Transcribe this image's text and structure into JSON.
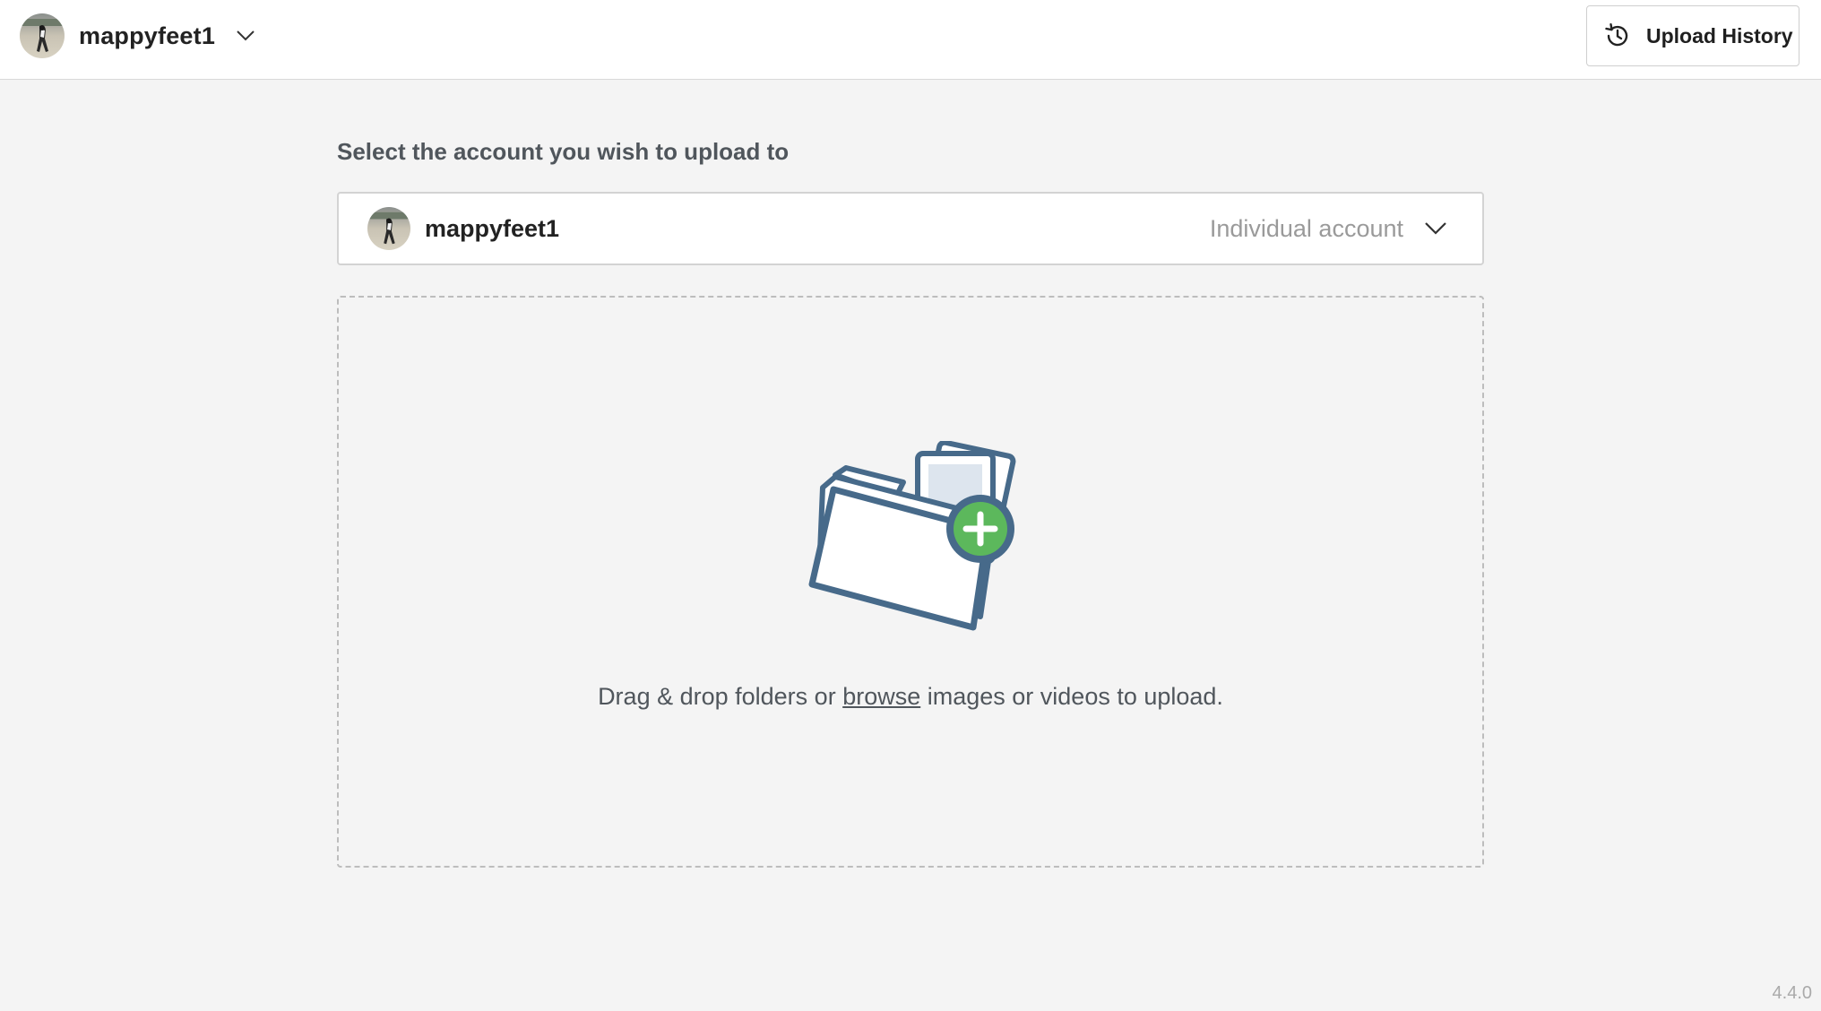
{
  "header": {
    "username": "mappyfeet1",
    "history_button_label": "Upload History"
  },
  "main": {
    "section_label": "Select the account you wish to upload to",
    "account": {
      "name": "mappyfeet1",
      "type": "Individual account"
    },
    "dropzone": {
      "text_before": "Drag & drop folders or ",
      "browse_link": "browse",
      "text_after": " images or videos to upload."
    }
  },
  "footer": {
    "version": "4.4.0"
  },
  "icons": {
    "header_dropdown": "chevron-down-icon",
    "history": "history-clock-icon",
    "account_dropdown": "chevron-down-icon",
    "illustration": "folder-add-icon"
  },
  "colors": {
    "folder_stroke": "#476a8a",
    "add_badge": "#5cb85c",
    "background": "#f4f4f4"
  }
}
